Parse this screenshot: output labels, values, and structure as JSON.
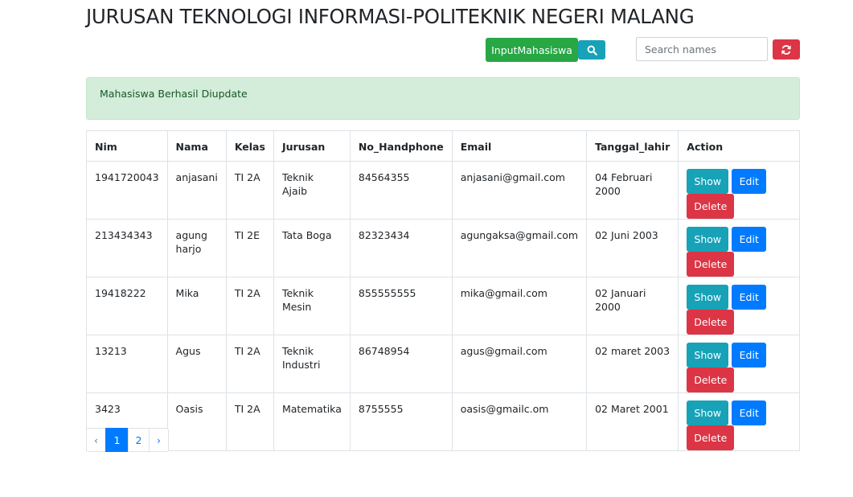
{
  "header": {
    "title": "JURUSAN TEKNOLOGI INFORMASI-POLITEKNIK NEGERI MALANG"
  },
  "toolbar": {
    "input_label": "InputMahasiswa",
    "search_icon": "search-icon",
    "search_placeholder": "Search names",
    "reset_icon": "refresh-icon",
    "colors": {
      "success": "#28a745",
      "info": "#17a2b8",
      "danger": "#dc3545",
      "primary": "#007bff"
    }
  },
  "alert": {
    "message": "Mahasiswa Berhasil Diupdate"
  },
  "table": {
    "headers": [
      "Nim",
      "Nama",
      "Kelas",
      "Jurusan",
      "No_Handphone",
      "Email",
      "Tanggal_lahir",
      "Action"
    ],
    "rows": [
      {
        "nim": "1941720043",
        "nama": "anjasani",
        "kelas": "TI 2A",
        "jurusan": "Teknik Ajaib",
        "no_handphone": "84564355",
        "email": "anjasani@gmail.com",
        "tanggal_lahir": "04 Februari 2000"
      },
      {
        "nim": "213434343",
        "nama": "agung harjo",
        "kelas": "TI 2E",
        "jurusan": "Tata Boga",
        "no_handphone": "82323434",
        "email": "agungaksa@gmail.com",
        "tanggal_lahir": "02 Juni 2003"
      },
      {
        "nim": "19418222",
        "nama": "Mika",
        "kelas": "TI 2A",
        "jurusan": "Teknik Mesin",
        "no_handphone": "855555555",
        "email": "mika@gmail.com",
        "tanggal_lahir": "02 Januari 2000"
      },
      {
        "nim": "13213",
        "nama": "Agus",
        "kelas": "TI 2A",
        "jurusan": "Teknik Industri",
        "no_handphone": "86748954",
        "email": "agus@gmail.com",
        "tanggal_lahir": "02 maret 2003"
      },
      {
        "nim": "3423",
        "nama": "Oasis",
        "kelas": "TI 2A",
        "jurusan": "Matematika",
        "no_handphone": "8755555",
        "email": "oasis@gmailc.om",
        "tanggal_lahir": "02 Maret 2001"
      }
    ],
    "actions": {
      "show": "Show",
      "edit": "Edit",
      "delete": "Delete"
    }
  },
  "pagination": {
    "prev": "‹",
    "pages": [
      "1",
      "2"
    ],
    "active": "1",
    "next": "›"
  }
}
